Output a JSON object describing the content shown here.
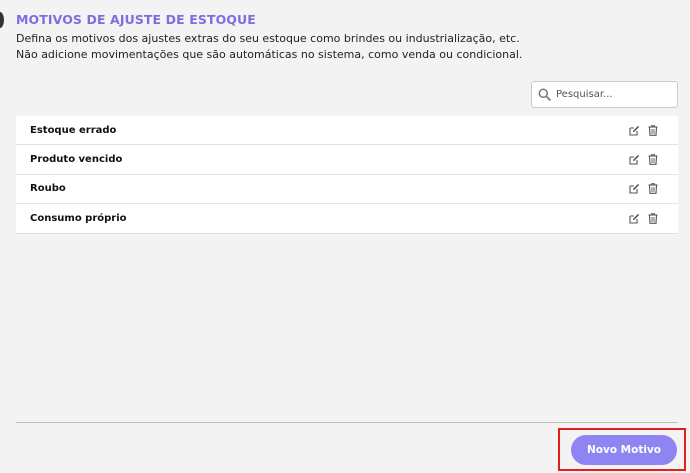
{
  "header": {
    "title": "MOTIVOS DE AJUSTE DE ESTOQUE",
    "description_line1": "Defina os motivos dos ajustes extras do seu estoque como brindes ou industrialização, etc.",
    "description_line2": "Não adicione movimentações que são automáticas no sistema, como venda ou condicional."
  },
  "search": {
    "placeholder": "Pesquisar...",
    "value": "",
    "icon": "search-icon"
  },
  "reasons": [
    {
      "label": "Estoque errado"
    },
    {
      "label": "Produto vencido"
    },
    {
      "label": "Roubo"
    },
    {
      "label": "Consumo próprio"
    }
  ],
  "row_actions": {
    "edit_icon": "edit-icon",
    "delete_icon": "trash-icon"
  },
  "footer": {
    "new_button_label": "Novo Motivo"
  },
  "colors": {
    "accent": "#7b6fe0",
    "button": "#8f85f2",
    "highlight": "#e0201c",
    "background": "#f3f3f3"
  }
}
